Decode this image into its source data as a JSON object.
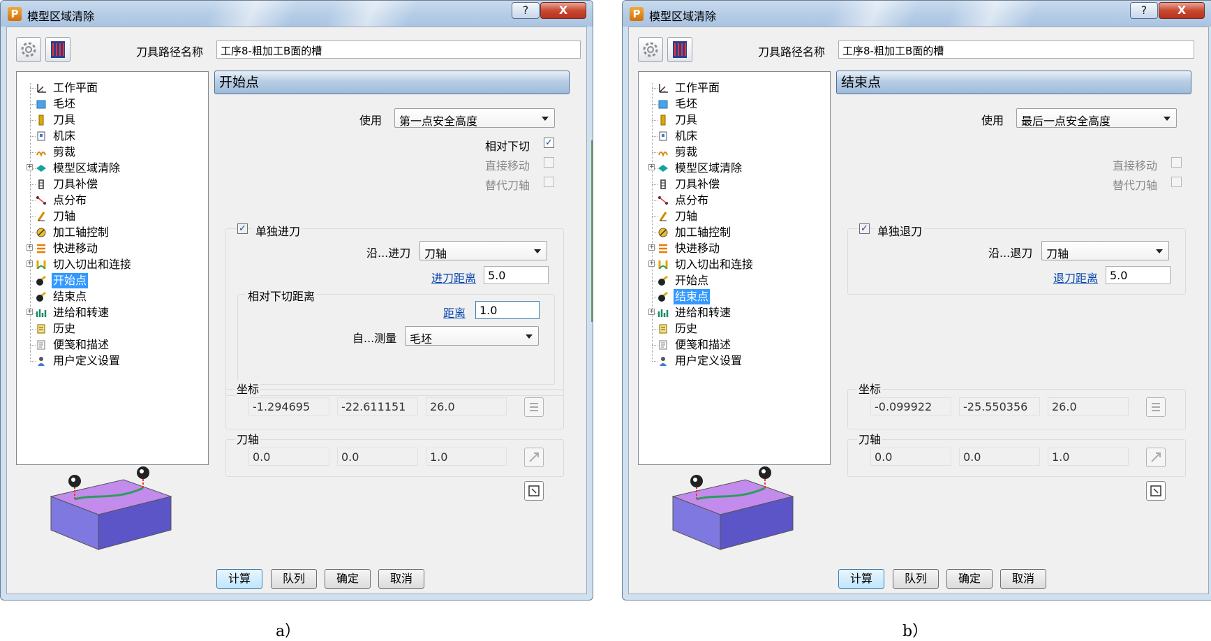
{
  "tree_items": [
    "工作平面",
    "毛坯",
    "刀具",
    "机床",
    "剪裁",
    "模型区域清除",
    "刀具补偿",
    "点分布",
    "刀轴",
    "加工轴控制",
    "快进移动",
    "切入切出和连接",
    "开始点",
    "结束点",
    "进给和转速",
    "历史",
    "便笺和描述",
    "用户定义设置"
  ],
  "icon_names": [
    "workplane-icon",
    "stock-icon",
    "tool-icon",
    "machine-icon",
    "trim-icon",
    "area-clear-icon",
    "tool-comp-icon",
    "point-dist-icon",
    "tool-axis-icon",
    "axis-control-icon",
    "rapid-move-icon",
    "leads-links-icon",
    "start-point-icon",
    "end-point-icon",
    "feed-speed-icon",
    "history-icon",
    "notes-icon",
    "user-settings-icon"
  ],
  "expandable": [
    5,
    10,
    11,
    14
  ],
  "colors": {
    "selected": "#3399ff",
    "close": "#c94a33",
    "link": "#0645ad",
    "block_top": "#c28bec",
    "block_side": "#6a5acd",
    "toolpath": "#2a9d5a"
  },
  "left": {
    "title": "模型区域清除",
    "help": "?",
    "close": "X",
    "path_label": "刀具路径名称",
    "path_value": "工序8-粗加工B面的槽",
    "selected_index": 12,
    "header": "开始点",
    "use_label": "使用",
    "use_value": "第一点安全高度",
    "opt_relative": {
      "label": "相对下切",
      "checked": true
    },
    "opt_direct": {
      "label": "直接移动",
      "checked": false
    },
    "opt_alt_axis": {
      "label": "替代刀轴",
      "checked": false
    },
    "separate_label": "单独进刀",
    "along_label": "沿...进刀",
    "along_value": "刀轴",
    "dist_link": "进刀距离",
    "dist_value": "5.0",
    "rel_group_title": "相对下切距离",
    "rel_dist_link": "距离",
    "rel_dist_value": "1.0",
    "measure_label": "自...测量",
    "measure_value": "毛坯",
    "coords_title": "坐标",
    "coords": [
      "-1.294695",
      "-22.611151",
      "26.0"
    ],
    "axis_title": "刀轴",
    "axis": [
      "0.0",
      "0.0",
      "1.0"
    ],
    "buttons": [
      "计算",
      "队列",
      "确定",
      "取消"
    ],
    "caption": "a）"
  },
  "right": {
    "title": "模型区域清除",
    "help": "?",
    "close": "X",
    "path_label": "刀具路径名称",
    "path_value": "工序8-粗加工B面的槽",
    "selected_index": 13,
    "header": "结束点",
    "use_label": "使用",
    "use_value": "最后一点安全高度",
    "opt_direct": {
      "label": "直接移动",
      "checked": false
    },
    "opt_alt_axis": {
      "label": "替代刀轴",
      "checked": false
    },
    "separate_label": "单独退刀",
    "along_label": "沿...退刀",
    "along_value": "刀轴",
    "dist_link": "退刀距离",
    "dist_value": "5.0",
    "coords_title": "坐标",
    "coords": [
      "-0.099922",
      "-25.550356",
      "26.0"
    ],
    "axis_title": "刀轴",
    "axis": [
      "0.0",
      "0.0",
      "1.0"
    ],
    "buttons": [
      "计算",
      "队列",
      "确定",
      "取消"
    ],
    "caption": "b）"
  }
}
